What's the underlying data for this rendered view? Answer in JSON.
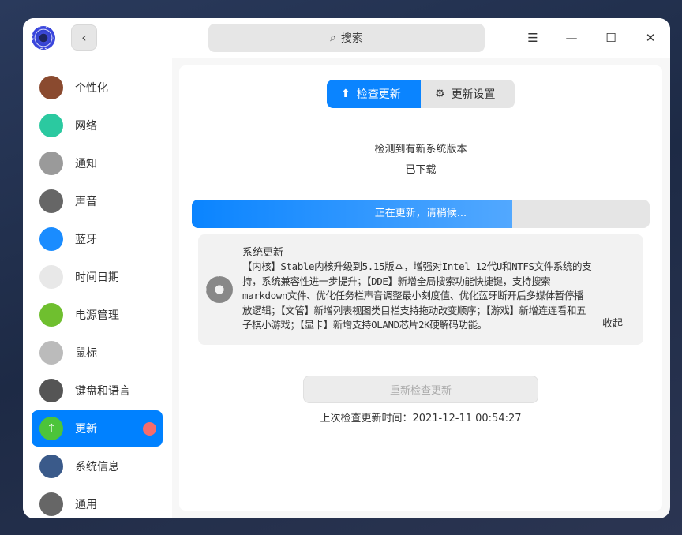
{
  "titlebar": {
    "search_placeholder": "搜索",
    "back": "‹"
  },
  "sidebar": {
    "items": [
      {
        "label": "个性化",
        "icon": "palette-icon",
        "color": "#8a4a2f"
      },
      {
        "label": "网络",
        "icon": "network-icon",
        "color": "#2bc9a0"
      },
      {
        "label": "通知",
        "icon": "bell-icon",
        "color": "#9a9a9a"
      },
      {
        "label": "声音",
        "icon": "speaker-icon",
        "color": "#666666"
      },
      {
        "label": "蓝牙",
        "icon": "bluetooth-icon",
        "color": "#1a8cff"
      },
      {
        "label": "时间日期",
        "icon": "clock-icon",
        "color": "#e8e8e8"
      },
      {
        "label": "电源管理",
        "icon": "battery-icon",
        "color": "#6fbf2f"
      },
      {
        "label": "鼠标",
        "icon": "mouse-icon",
        "color": "#bbbbbb"
      },
      {
        "label": "键盘和语言",
        "icon": "keyboard-icon",
        "color": "#555555"
      },
      {
        "label": "更新",
        "icon": "update-icon",
        "color": "#4cc43a"
      },
      {
        "label": "系统信息",
        "icon": "system-info-icon",
        "color": "#3a5a8a"
      },
      {
        "label": "通用",
        "icon": "general-icon",
        "color": "#666666"
      }
    ],
    "selected": 9
  },
  "tabs": {
    "check": "检查更新",
    "settings": "更新设置"
  },
  "status": {
    "line1": "检测到有新系统版本",
    "line2": "已下载"
  },
  "progress": {
    "label": "正在更新，请稍候...",
    "fraction": 0.7
  },
  "log": {
    "title": "系统更新",
    "text": "【内核】Stable内核升级到5.15版本，增强对Intel 12代U和NTFS文件系统的支持，系统兼容性进一步提升；【DDE】新增全局搜索功能快捷键，支持搜索markdown文件、优化任务栏声音调整最小刻度值、优化蓝牙断开后多媒体暂停播放逻辑；【文管】新增列表视图类目栏支持拖动改变顺序；【游戏】新增连连看和五子棋小游戏；【显卡】新增支持OLAND芯片2K硬解码功能。",
    "collapse": "收起"
  },
  "recheck": "重新检查更新",
  "last_check": "上次检查更新时间：2021-12-11 00:54:27",
  "accent": "#0081ff"
}
